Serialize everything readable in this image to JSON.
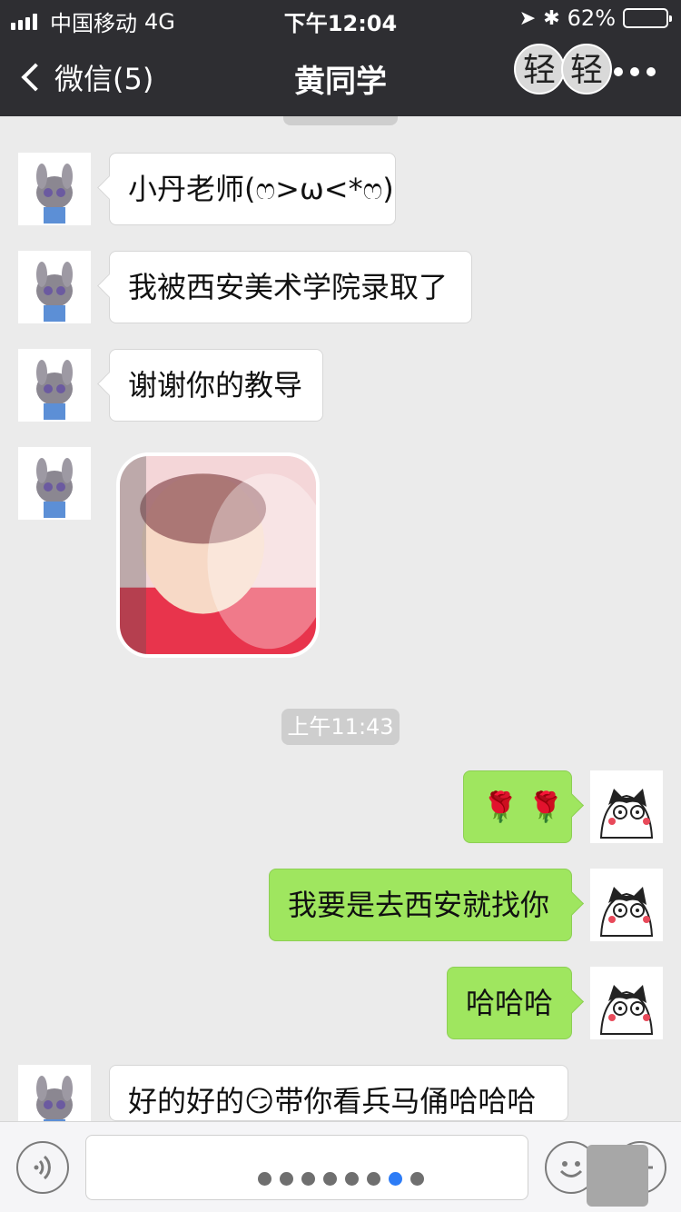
{
  "status_bar": {
    "carrier": "中国移动",
    "network": "4G",
    "time": "下午12:04",
    "battery": "62%",
    "battery_level": 0.62
  },
  "nav": {
    "back_label": "微信(5)",
    "title": "黄同学",
    "badge_chars": [
      "轻",
      "轻"
    ]
  },
  "timestamp": "上午11:43",
  "messages": [
    {
      "side": "in",
      "text": "小丹老师(ෆ>ω<*ෆ)"
    },
    {
      "side": "in",
      "text": "我被西安美术学院录取了"
    },
    {
      "side": "in",
      "text": "谢谢你的教导"
    },
    {
      "side": "in",
      "type": "image"
    },
    {
      "side": "out",
      "text": "🌹 🌹"
    },
    {
      "side": "out",
      "text": "我要是去西安就找你"
    },
    {
      "side": "out",
      "text": "哈哈哈"
    },
    {
      "side": "in",
      "text": "好的好的😏带你看兵马俑哈哈哈"
    }
  ],
  "input": {
    "placeholder": "",
    "page_dots": 8,
    "active_dot": 6
  },
  "colors": {
    "nav": "#2e2e32",
    "chat_bg": "#ebebeb",
    "out_bubble": "#9fe65f",
    "in_bubble": "#ffffff",
    "active_dot": "#2d7cf6"
  },
  "icons": {
    "voice": "voice-icon",
    "emoji": "smile-icon",
    "plus": "plus-icon",
    "back": "chevron-left-icon",
    "more": "more-dots-icon"
  }
}
